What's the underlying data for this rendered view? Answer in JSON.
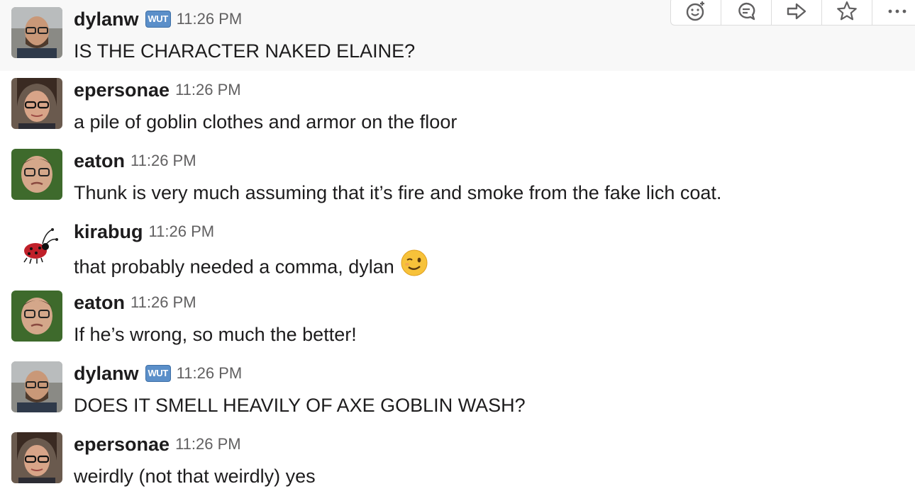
{
  "messages": [
    {
      "user": "dylanw",
      "badge": "WUT",
      "time": "11:26 PM",
      "text": "IS THE CHARACTER NAKED ELAINE?"
    },
    {
      "user": "epersonae",
      "time": "11:26 PM",
      "text": "a pile of goblin clothes and armor on the floor"
    },
    {
      "user": "eaton",
      "time": "11:26 PM",
      "text": "Thunk is very much assuming that it’s fire and smoke from the fake lich coat."
    },
    {
      "user": "kirabug",
      "time": "11:26 PM",
      "text": "that probably needed a comma, dylan",
      "emoji": "wink-emoji"
    },
    {
      "user": "eaton",
      "time": "11:26 PM",
      "text": "If he’s wrong, so much the better!"
    },
    {
      "user": "dylanw",
      "badge": "WUT",
      "time": "11:26 PM",
      "text": "DOES IT SMELL HEAVILY OF AXE GOBLIN WASH?"
    },
    {
      "user": "epersonae",
      "time": "11:26 PM",
      "text": "weirdly (not that weirdly) yes"
    }
  ],
  "actions": [
    "add-reaction-icon",
    "start-thread-icon",
    "share-message-icon",
    "star-icon",
    "more-actions-icon"
  ],
  "colors": {
    "hover_bg": "#f8f8f8",
    "badge": "#5b8fc9",
    "timestamp": "#616061"
  }
}
